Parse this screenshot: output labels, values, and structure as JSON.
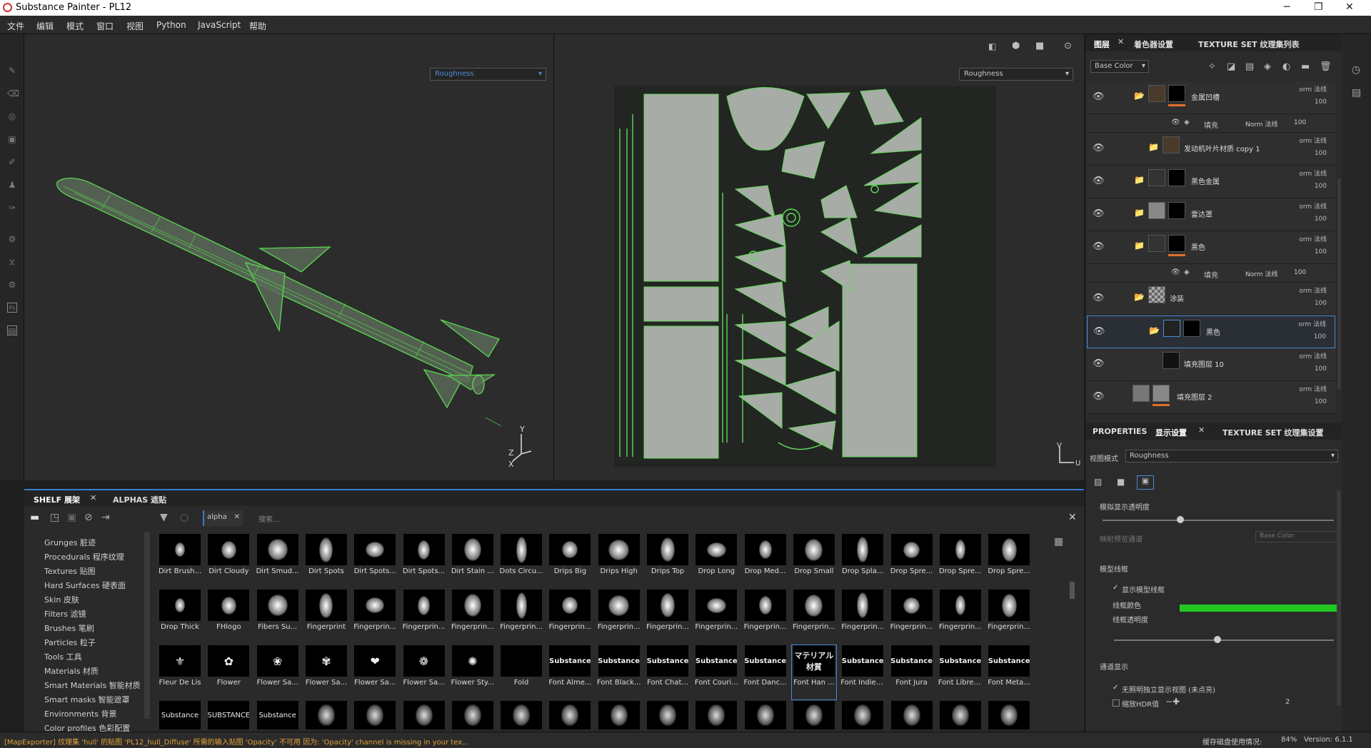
{
  "app": {
    "title": "Substance Painter - PL12"
  },
  "menu": [
    "文件",
    "编辑",
    "模式",
    "窗口",
    "视图",
    "Python",
    "JavaScript",
    "帮助"
  ],
  "viewport": {
    "left_channel": "Roughness",
    "right_channel": "Roughness"
  },
  "layers_panel": {
    "tabs": [
      "图层",
      "着色器设置",
      "TEXTURE SET 纹理集列表"
    ],
    "channel_select": "Base Color",
    "layers": [
      {
        "name": "金属凹槽",
        "blend": "orm 法线",
        "opacity": "100"
      },
      {
        "name": "发动机叶片材质 copy 1",
        "blend": "orm 法线",
        "opacity": "100"
      },
      {
        "name": "黑色金属",
        "blend": "orm 法线",
        "opacity": "100"
      },
      {
        "name": "雷达罩",
        "blend": "orm 法线",
        "opacity": "100"
      },
      {
        "name": "黑色",
        "blend": "orm 法线",
        "opacity": "100"
      },
      {
        "name": "涂装",
        "blend": "orm 法线",
        "opacity": "100"
      },
      {
        "name": "黑色",
        "blend": "orm 法线",
        "opacity": "100"
      },
      {
        "name": "填充图层 10",
        "blend": "orm 法线",
        "opacity": "100"
      },
      {
        "name": "填充图层 2",
        "blend": "orm 法线",
        "opacity": "100"
      }
    ],
    "fill_sublayers": [
      {
        "name": "填充",
        "blend": "Norm 法线",
        "opacity": "100"
      },
      {
        "name": "填充",
        "blend": "Norm 法线",
        "opacity": "100"
      }
    ]
  },
  "properties_panel": {
    "tabs": [
      "PROPERTIES",
      "显示设置",
      "TEXTURE SET 纹理集设置"
    ],
    "view_mode_label": "视图模式",
    "view_mode_value": "Roughness",
    "map_opacity_label": "模拟显示透明度",
    "map_preview_label": "映射预览通道",
    "map_preview_value": "Base Color",
    "wireframe_section": "模型线框",
    "show_wireframe_label": "显示模型线框",
    "wire_color_label": "线框颜色",
    "wire_opacity_label": "线框透明度",
    "wire_color": "#22c822",
    "channel_section": "通道显示",
    "solo_label": "无照明独立显示视图 (未点亮)",
    "hdr_label": "缩放HDR值",
    "hdr_value": "2"
  },
  "shelf": {
    "tabs": [
      "SHELF 展架",
      "ALPHAS 遮贴"
    ],
    "filter_tag": "alpha",
    "search_placeholder": "搜索...",
    "categories": [
      "Grunges 脏迹",
      "Procedurals 程序纹理",
      "Textures 贴图",
      "Hard Surfaces 硬表面",
      "Skin 皮肤",
      "Filters 滤镜",
      "Brushes 笔刷",
      "Particles 粒子",
      "Tools 工具",
      "Materials 材质",
      "Smart Materials 智能材质",
      "Smart masks 智能遮罩",
      "Environments 背景",
      "Color profiles 色彩配置"
    ],
    "row1": [
      "Dirt Brush...",
      "Dirt Cloudy",
      "Dirt Smud...",
      "Dirt Spots",
      "Dirt Spots...",
      "Dirt Spots...",
      "Dirt Stain ...",
      "Dots Circu...",
      "Drips Big",
      "Drips High",
      "Drips Top",
      "Drop Long",
      "Drop Med...",
      "Drop Small",
      "Drop Spla...",
      "Drop Spre...",
      "Drop Spre...",
      "Drop Spre..."
    ],
    "row2": [
      "Drop Thick",
      "FHlogo",
      "Fibers Su...",
      "Fingerprint",
      "Fingerprin...",
      "Fingerprin...",
      "Fingerprin...",
      "Fingerprin...",
      "Fingerprin...",
      "Fingerprin...",
      "Fingerprin...",
      "Fingerprin...",
      "Fingerprin...",
      "Fingerprin...",
      "Fingerprin...",
      "Fingerprin...",
      "Fingerprin...",
      "Fingerprin..."
    ],
    "row3": [
      "Fleur De Lis",
      "Flower",
      "Flower Sa...",
      "Flower Sa...",
      "Flower Sa...",
      "Flower Sa...",
      "Flower Sty...",
      "Fold",
      "Font Alme...",
      "Font Black...",
      "Font Chat...",
      "Font Couri...",
      "Font Danc...",
      "Font Han ...",
      "Font Indie ...",
      "Font Jura",
      "Font Libre ...",
      "Font Meta..."
    ],
    "row3_previews": [
      "⚜",
      "✿",
      "❀",
      "✾",
      "❤",
      "❁",
      "✺",
      "",
      "Substance",
      "Substance",
      "Substance",
      "Substance",
      "Substance",
      "マテリアル材質",
      "Substance",
      "Substance",
      "Substance",
      "Substance"
    ],
    "row4_previews": [
      "Substance",
      "SUBSTANCE",
      "Substance"
    ]
  },
  "status": {
    "message": "[MapExporter] 纹理集 'hull' 的贴图 'PL12_hull_Diffuse' 所需的输入贴图 'Opacity' 不可用 因为: 'Opacity' channel is missing in your tex...",
    "cache_label": "缓存磁盘使用情况:",
    "cache_value": "84%",
    "version": "Version: 6.1.1"
  }
}
